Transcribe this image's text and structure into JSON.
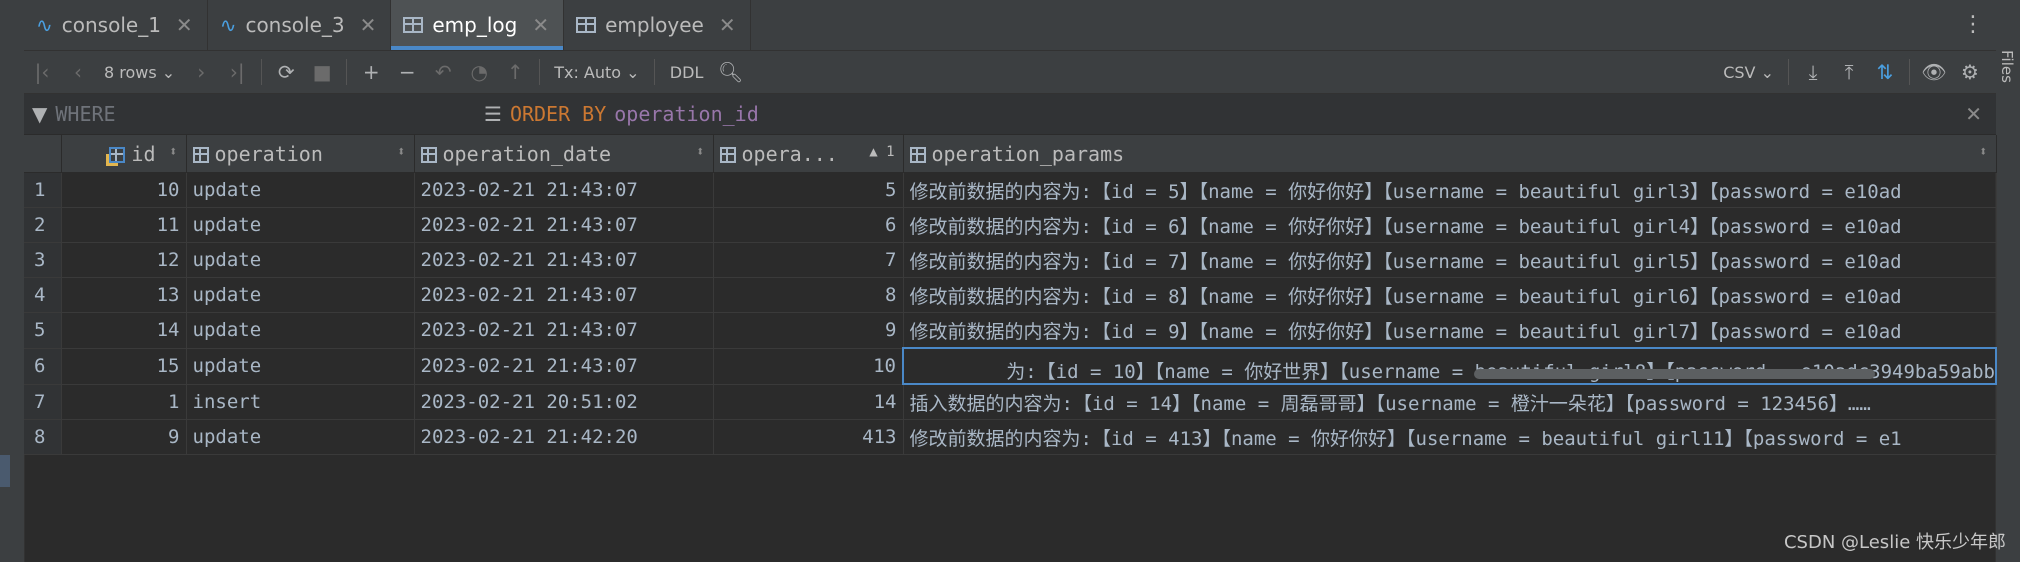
{
  "tabs": [
    {
      "label": "console_1",
      "icon": "console-icon",
      "active": false
    },
    {
      "label": "console_3",
      "icon": "console-icon",
      "active": false
    },
    {
      "label": "emp_log",
      "icon": "table-icon",
      "active": true
    },
    {
      "label": "employee",
      "icon": "table-icon",
      "active": false
    }
  ],
  "toolbar": {
    "rows_label": "8 rows",
    "tx_label": "Tx: Auto",
    "ddl_label": "DDL",
    "csv_label": "CSV"
  },
  "right_strip": {
    "files_label": "Files"
  },
  "filter": {
    "where_label": "WHERE",
    "order_keyword": "ORDER BY",
    "order_field": "operation_id"
  },
  "grid": {
    "columns": [
      {
        "name": "id",
        "sort": "both"
      },
      {
        "name": "operation",
        "sort": "both"
      },
      {
        "name": "operation_date",
        "sort": "both"
      },
      {
        "name": "opera...",
        "sort": "asc",
        "sort_index": "1"
      },
      {
        "name": "operation_params",
        "sort": "both"
      }
    ],
    "rows": [
      {
        "n": "1",
        "id": "10",
        "op": "update",
        "date": "2023-02-21 21:43:07",
        "opid": "5",
        "params": "修改前数据的内容为:【id = 5】【name = 你好你好】【username = beautiful girl3】【password = e10ad"
      },
      {
        "n": "2",
        "id": "11",
        "op": "update",
        "date": "2023-02-21 21:43:07",
        "opid": "6",
        "params": "修改前数据的内容为:【id = 6】【name = 你好你好】【username = beautiful girl4】【password = e10ad"
      },
      {
        "n": "3",
        "id": "12",
        "op": "update",
        "date": "2023-02-21 21:43:07",
        "opid": "7",
        "params": "修改前数据的内容为:【id = 7】【name = 你好你好】【username = beautiful girl5】【password = e10ad"
      },
      {
        "n": "4",
        "id": "13",
        "op": "update",
        "date": "2023-02-21 21:43:07",
        "opid": "8",
        "params": "修改前数据的内容为:【id = 8】【name = 你好你好】【username = beautiful girl6】【password = e10ad"
      },
      {
        "n": "5",
        "id": "14",
        "op": "update",
        "date": "2023-02-21 21:43:07",
        "opid": "9",
        "params": "修改前数据的内容为:【id = 9】【name = 你好你好】【username = beautiful girl7】【password = e10ad"
      },
      {
        "n": "6",
        "id": "15",
        "op": "update",
        "date": "2023-02-21 21:43:07",
        "opid": "10",
        "params": "为:【id = 10】【name = 你好世界】【username = beautiful girl8】【password = e10adc3949ba59abb"
      },
      {
        "n": "7",
        "id": "1",
        "op": "insert",
        "date": "2023-02-21 20:51:02",
        "opid": "14",
        "params": "插入数据的内容为:【id = 14】【name = 周磊哥哥】【username = 橙汁一朵花】【password = 123456】……"
      },
      {
        "n": "8",
        "id": "9",
        "op": "update",
        "date": "2023-02-21 21:42:20",
        "opid": "413",
        "params": "修改前数据的内容为:【id = 413】【name = 你好你好】【username = beautiful girl11】【password = e1"
      }
    ]
  },
  "watermark": "CSDN @Leslie 快乐少年郎"
}
